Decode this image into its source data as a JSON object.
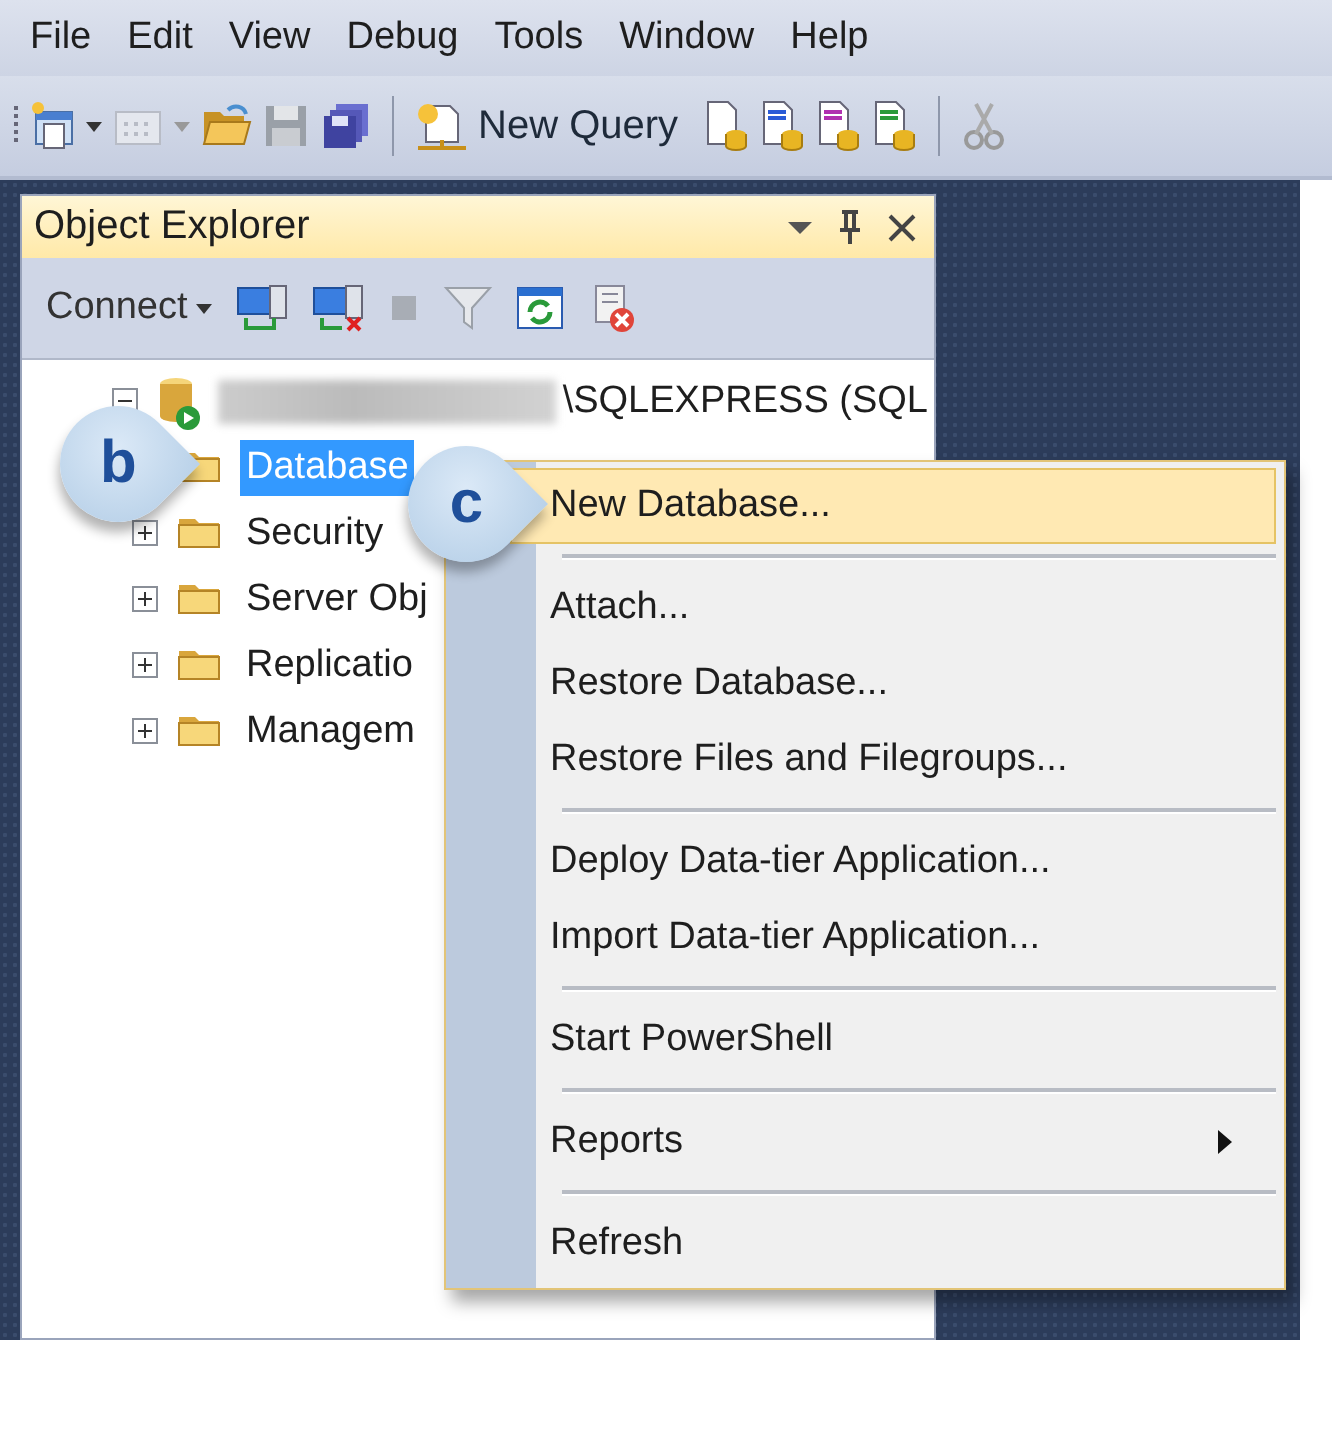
{
  "menu_bar": [
    {
      "label": "File"
    },
    {
      "label": "Edit"
    },
    {
      "label": "View"
    },
    {
      "label": "Debug"
    },
    {
      "label": "Tools"
    },
    {
      "label": "Window"
    },
    {
      "label": "Help"
    }
  ],
  "toolbar": {
    "new_query": "New Query"
  },
  "object_explorer": {
    "title": "Object Explorer",
    "connect": "Connect",
    "tree": [
      {
        "label": "\\SQLEXPRESS (SQL",
        "redacted_prefix": true,
        "expanded": true,
        "selected": false,
        "children": [
          {
            "label": "Database",
            "selected": true
          },
          {
            "label": "Security",
            "expanded": false,
            "selected": false
          },
          {
            "label": "Server Obj",
            "expanded": false,
            "selected": false
          },
          {
            "label": "Replicatio",
            "expanded": false,
            "selected": false
          },
          {
            "label": "Managem",
            "expanded": false,
            "selected": false
          }
        ]
      }
    ]
  },
  "context_menu": {
    "groups": [
      [
        {
          "label": "New Database...",
          "selected": true
        }
      ],
      [
        {
          "label": "Attach...",
          "selected": false
        },
        {
          "label": "Restore Database...",
          "selected": false
        },
        {
          "label": "Restore Files and Filegroups...",
          "selected": false
        }
      ],
      [
        {
          "label": "Deploy Data-tier Application...",
          "selected": false
        },
        {
          "label": "Import Data-tier Application...",
          "selected": false
        }
      ],
      [
        {
          "label": "Start PowerShell",
          "selected": false
        }
      ],
      [
        {
          "label": "Reports",
          "selected": false,
          "has_submenu": true
        }
      ],
      [
        {
          "label": "Refresh",
          "selected": false
        }
      ]
    ]
  },
  "callouts": [
    {
      "label": "b"
    },
    {
      "label": "c"
    }
  ]
}
